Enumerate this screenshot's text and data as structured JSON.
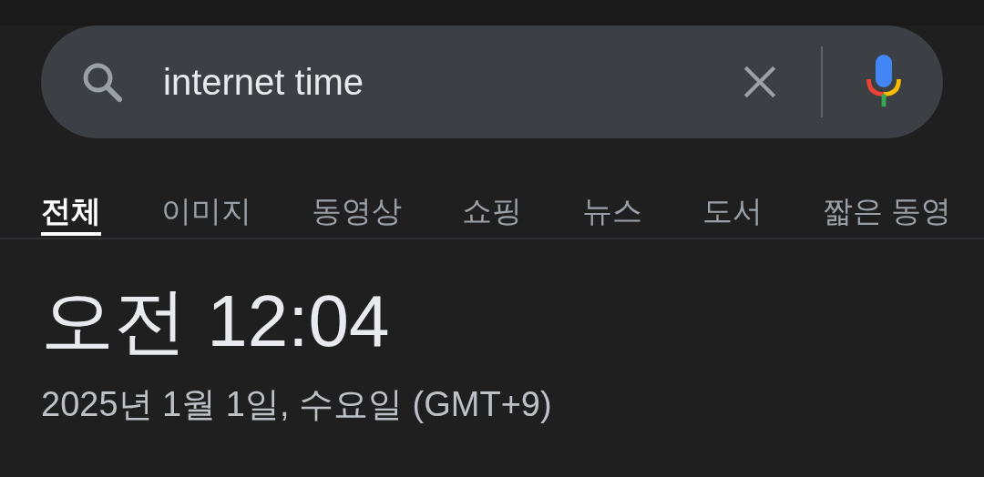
{
  "search": {
    "value": "internet time"
  },
  "tabs": [
    {
      "label": "전체",
      "selected": true
    },
    {
      "label": "이미지",
      "selected": false
    },
    {
      "label": "동영상",
      "selected": false
    },
    {
      "label": "쇼핑",
      "selected": false
    },
    {
      "label": "뉴스",
      "selected": false
    },
    {
      "label": "도서",
      "selected": false
    },
    {
      "label": "짧은 동영",
      "selected": false
    }
  ],
  "time": "오전 12:04",
  "date": "2025년 1월 1일, 수요일 (GMT+9)"
}
